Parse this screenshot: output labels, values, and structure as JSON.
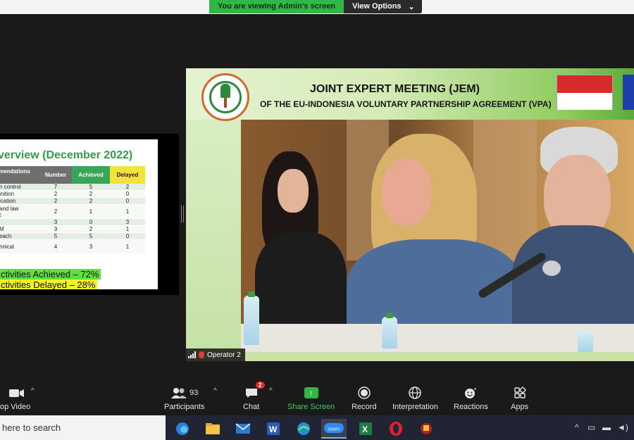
{
  "banner": {
    "viewing": "You are viewing Admin's screen",
    "view_options": "View Options"
  },
  "slide": {
    "title": "verview (December 2022)",
    "headers": [
      "mendations",
      "Number",
      "Achieved",
      "Delayed"
    ],
    "rows": [
      [
        "n control",
        "7",
        "5",
        "2"
      ],
      [
        "inition",
        "2",
        "2",
        "0"
      ],
      [
        "ication",
        "2",
        "2",
        "0"
      ],
      [
        "and law\nt",
        "2",
        "1",
        "1"
      ],
      [
        "",
        "3",
        "0",
        "3"
      ],
      [
        "M",
        "3",
        "2",
        "1"
      ],
      [
        "each",
        "5",
        "5",
        "0"
      ],
      [
        "hnical",
        "4",
        "3",
        "1"
      ]
    ],
    "achieved": "ctivities Achieved – 72%",
    "delayed": "ctivities Delayed – 28%"
  },
  "video": {
    "title_line1": "JOINT EXPERT MEETING (JEM)",
    "title_line2": "OF THE EU-INDONESIA VOLUNTARY PARTNERSHIP AGREEMENT (VPA)",
    "participant_name": "Operator 2"
  },
  "toolbar": {
    "video": "op Video",
    "participants": "Participants",
    "participants_count": "93",
    "chat": "Chat",
    "chat_badge": "2",
    "share_screen": "Share Screen",
    "record": "Record",
    "interpretation": "Interpretation",
    "reactions": "Reactions",
    "apps": "Apps"
  },
  "taskbar": {
    "search": "here to search",
    "apps": [
      "edge-icon",
      "file-explorer-icon",
      "mail-icon",
      "word-icon",
      "edge-browser-icon",
      "zoom-icon",
      "excel-icon",
      "opera-icon",
      "game-icon"
    ],
    "zoom_label": "zoom"
  },
  "colors": {
    "share_green": "#2fb845",
    "achieved_green": "#3aa559",
    "delayed_yellow": "#f1e33b"
  }
}
